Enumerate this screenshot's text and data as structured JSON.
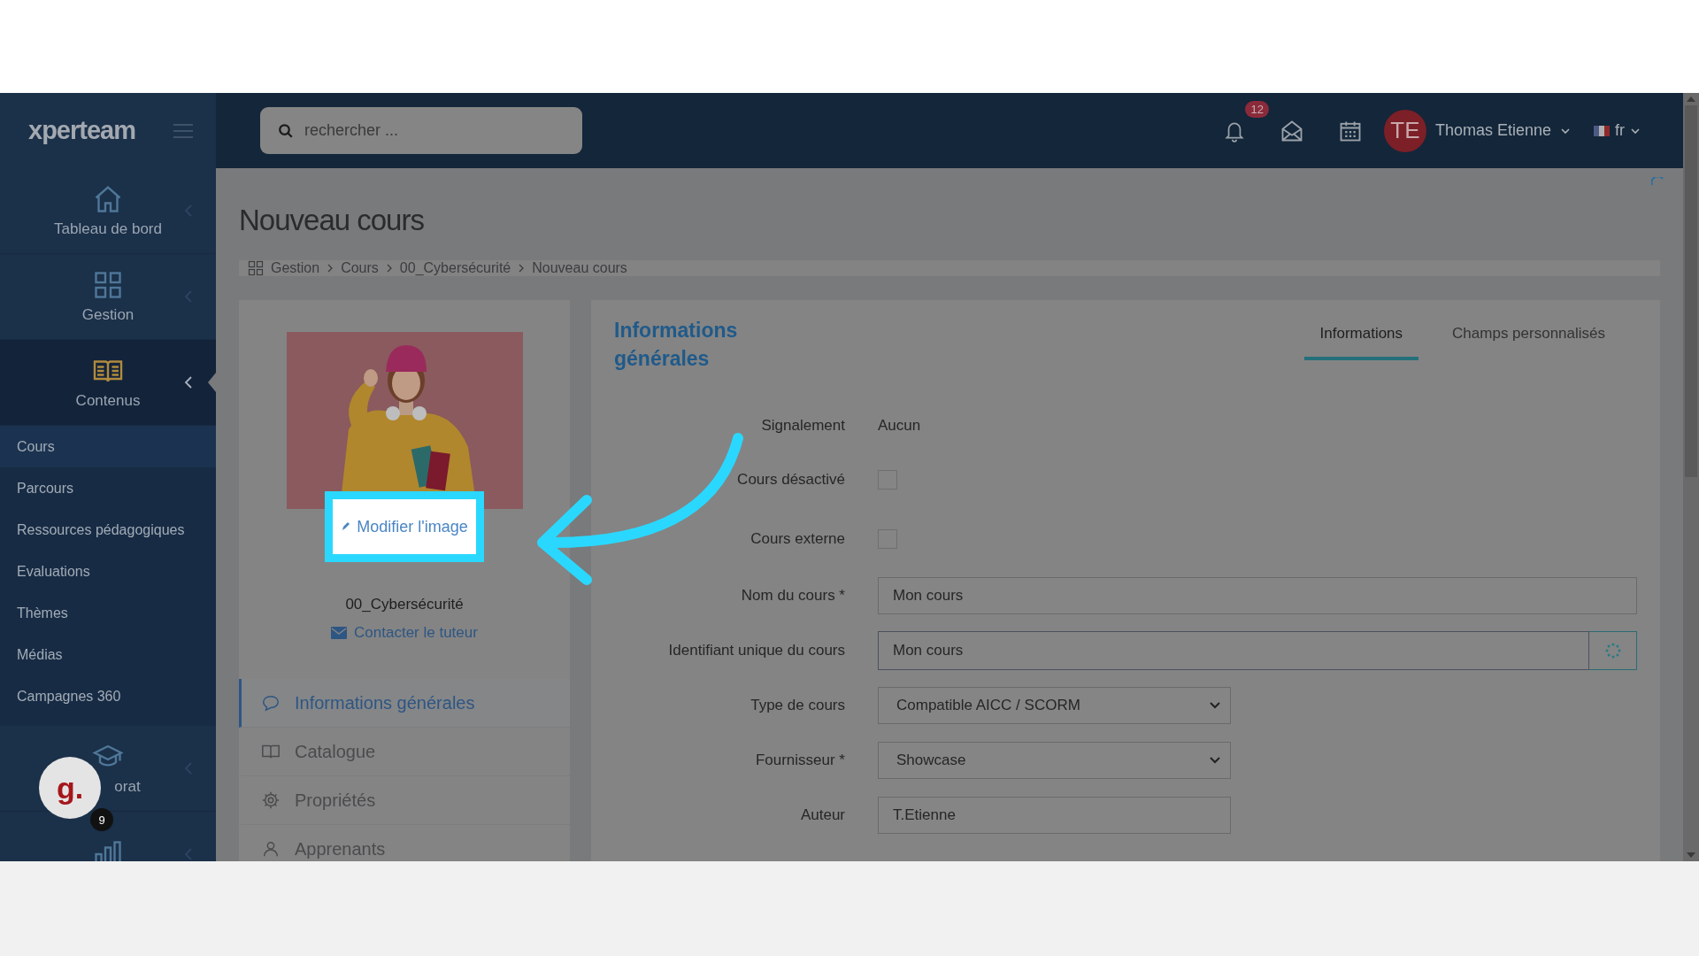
{
  "app": {
    "logo": "xperteam"
  },
  "header": {
    "search": {
      "placeholder": "rechercher ..."
    },
    "notifications": "12",
    "user": {
      "initials": "TE",
      "name": "Thomas Etienne"
    },
    "language": "fr"
  },
  "sidebar": {
    "items": [
      {
        "kind": "home",
        "label": "Tableau de bord",
        "selected": false
      },
      {
        "kind": "grid",
        "label": "Gestion",
        "selected": false
      },
      {
        "kind": "book",
        "label": "Contenus",
        "selected": true,
        "children": [
          {
            "label": "Cours",
            "selected": true
          },
          {
            "label": "Parcours",
            "selected": false
          },
          {
            "label": "Ressources pédagogiques",
            "selected": false
          },
          {
            "label": "Evaluations",
            "selected": false
          },
          {
            "label": "Thèmes",
            "selected": false
          },
          {
            "label": "Médias",
            "selected": false
          },
          {
            "label": "Campagnes 360",
            "selected": false
          }
        ]
      },
      {
        "kind": "cap",
        "label": "orat",
        "selected": false
      },
      {
        "kind": "chart",
        "selected": false
      }
    ]
  },
  "assistant_button": {
    "label": "g.",
    "count": "9"
  },
  "page": {
    "title": "Nouveau cours",
    "breadcrumb": [
      "Gestion",
      "Cours",
      "00_Cybersécurité",
      "Nouveau cours"
    ]
  },
  "course_card": {
    "edit_image": "Modifier l'image",
    "name": "00_Cybersécurité",
    "contact": "Contacter le tuteur",
    "nav": [
      {
        "kind": "chat",
        "label": "Informations générales",
        "selected": true
      },
      {
        "kind": "book",
        "label": "Catalogue",
        "selected": false
      },
      {
        "kind": "gear",
        "label": "Propriétés",
        "selected": false
      },
      {
        "kind": "user",
        "label": "Apprenants",
        "selected": false
      }
    ]
  },
  "form": {
    "title": "Informations générales",
    "tabs": [
      {
        "label": "Informations",
        "selected": true
      },
      {
        "label": "Champs personnalisés",
        "selected": false
      }
    ],
    "fields": [
      {
        "kind": "text",
        "label": "Signalement",
        "value": "Aucun"
      },
      {
        "kind": "checkbox",
        "label": "Cours désactivé",
        "checked": false
      },
      {
        "kind": "checkbox",
        "label": "Cours externe",
        "checked": false
      },
      {
        "kind": "input",
        "label": "Nom du cours *",
        "value": "Mon cours"
      },
      {
        "kind": "addon",
        "label": "Identifiant unique du cours",
        "value": "Mon cours"
      },
      {
        "kind": "select",
        "label": "Type de cours",
        "value": "Compatible AICC / SCORM"
      },
      {
        "kind": "select",
        "label": "Fournisseur *",
        "value": "Showcase"
      },
      {
        "kind": "short",
        "label": "Auteur",
        "value": "T.Etienne"
      }
    ]
  }
}
